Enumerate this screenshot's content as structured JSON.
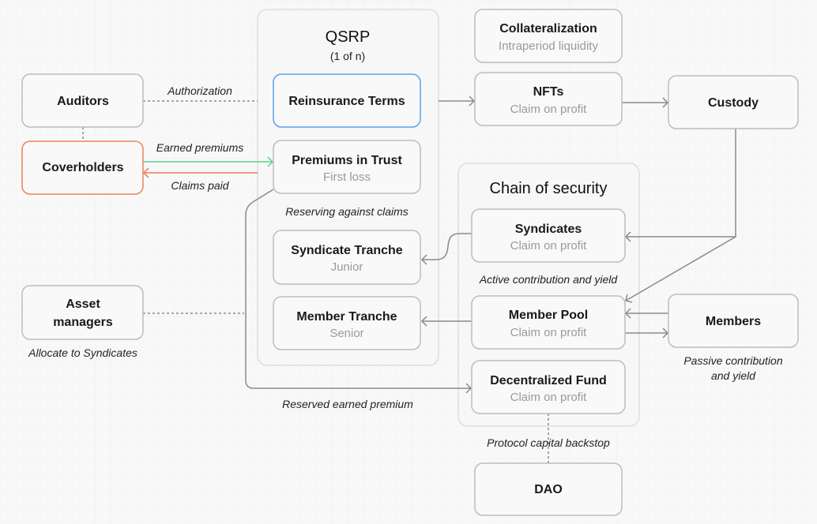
{
  "colors": {
    "accent_blue": "#5b9ff0",
    "coverholder_orange": "#f08060",
    "earned_green": "#5fd08a",
    "claims_orange": "#f07a5a",
    "line": "#8a8a8a"
  },
  "containers": {
    "qsrp": {
      "title": "QSRP",
      "subtitle": "(1 of n)"
    },
    "chain": {
      "title": "Chain of security"
    }
  },
  "nodes": {
    "collateralization": {
      "title": "Collateralization",
      "sub": "Intraperiod liquidity"
    },
    "auditors": {
      "title": "Auditors"
    },
    "reinsurance_terms": {
      "title": "Reinsurance Terms"
    },
    "nfts": {
      "title": "NFTs",
      "sub": "Claim on profit"
    },
    "custody": {
      "title": "Custody"
    },
    "coverholders": {
      "title": "Coverholders"
    },
    "premiums_in_trust": {
      "title": "Premiums in Trust",
      "sub": "First loss"
    },
    "syndicates": {
      "title": "Syndicates",
      "sub": "Claim on profit"
    },
    "syndicate_tranche": {
      "title": "Syndicate Tranche",
      "sub": "Junior"
    },
    "asset_managers": {
      "title1": "Asset",
      "title2": "managers"
    },
    "member_tranche": {
      "title": "Member Tranche",
      "sub": "Senior"
    },
    "member_pool": {
      "title": "Member Pool",
      "sub": "Claim on profit"
    },
    "members": {
      "title": "Members"
    },
    "decentralized_fund": {
      "title": "Decentralized Fund",
      "sub": "Claim on profit"
    },
    "dao": {
      "title": "DAO"
    }
  },
  "edge_labels": {
    "authorization": "Authorization",
    "earned_premiums": "Earned premiums",
    "claims_paid": "Claims paid",
    "reserving": "Reserving against claims",
    "active": "Active contribution and yield",
    "allocate": "Allocate to Syndicates",
    "passive1": "Passive contribution",
    "passive2": "and yield",
    "reserved": "Reserved earned premium",
    "backstop": "Protocol capital backstop"
  }
}
